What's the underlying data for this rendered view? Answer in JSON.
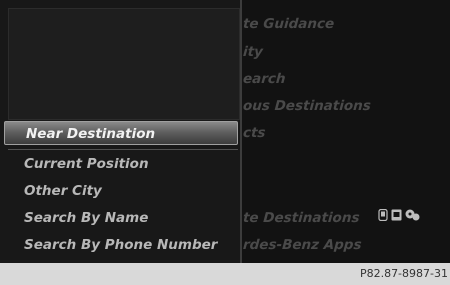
{
  "background_menu": {
    "items": [
      "te Guidance",
      "ity",
      "earch",
      "ous Destinations",
      "cts",
      "te Destinations",
      "rdes-Benz Apps"
    ]
  },
  "submenu": {
    "items": [
      {
        "label": "Near Destination",
        "selected": true
      },
      {
        "label": "Current Position",
        "selected": false
      },
      {
        "label": "Other City",
        "selected": false
      },
      {
        "label": "Search By Name",
        "selected": false
      },
      {
        "label": "Search By Phone Number",
        "selected": false
      }
    ]
  },
  "status_icons": [
    "phone-icon",
    "message-icon",
    "traffic-icon"
  ],
  "footer": {
    "ref": "P82.87-8987-31"
  },
  "colors": {
    "screen_bg": "#121212",
    "highlight": "#7a7a7a",
    "text": "#b8b8b8"
  }
}
